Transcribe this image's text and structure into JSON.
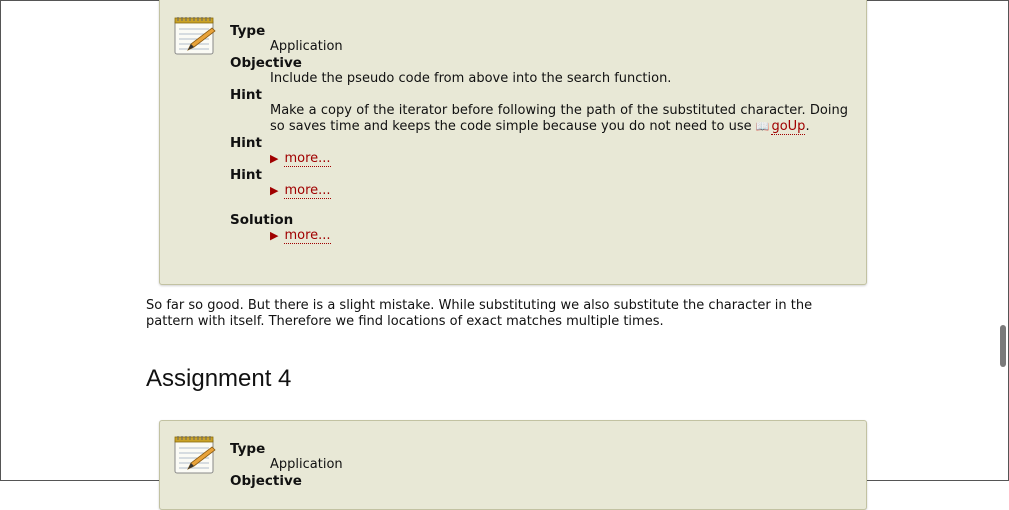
{
  "assignment3": {
    "type_label": "Type",
    "type_value": "Application",
    "objective_label": "Objective",
    "objective_value": "Include the pseudo code from above into the search function.",
    "hint1_label": "Hint",
    "hint1_text": "Make a copy of the iterator before following the path of the substituted character. Doing so saves time and keeps the code simple because you do not need to use",
    "hint1_link": "goUp",
    "hint1_end": ".",
    "hint2_label": "Hint",
    "hint2_more": "more...",
    "hint3_label": "Hint",
    "hint3_more": "more...",
    "solution_label": "Solution",
    "solution_more": "more..."
  },
  "paragraph": "So far so good. But there is a slight mistake. While substituting we also substitute the character in the pattern with itself. Therefore we find locations of exact matches multiple times.",
  "heading": "Assignment 4",
  "assignment4": {
    "type_label": "Type",
    "type_value": "Application",
    "objective_label": "Objective"
  },
  "icons": {
    "assignment": "notepad-pencil-icon",
    "book": "book-icon",
    "more": "triangle-right-icon"
  },
  "colors": {
    "box_bg": "#e8e8d6",
    "box_border": "#c2c2a2",
    "link": "#a00000"
  }
}
